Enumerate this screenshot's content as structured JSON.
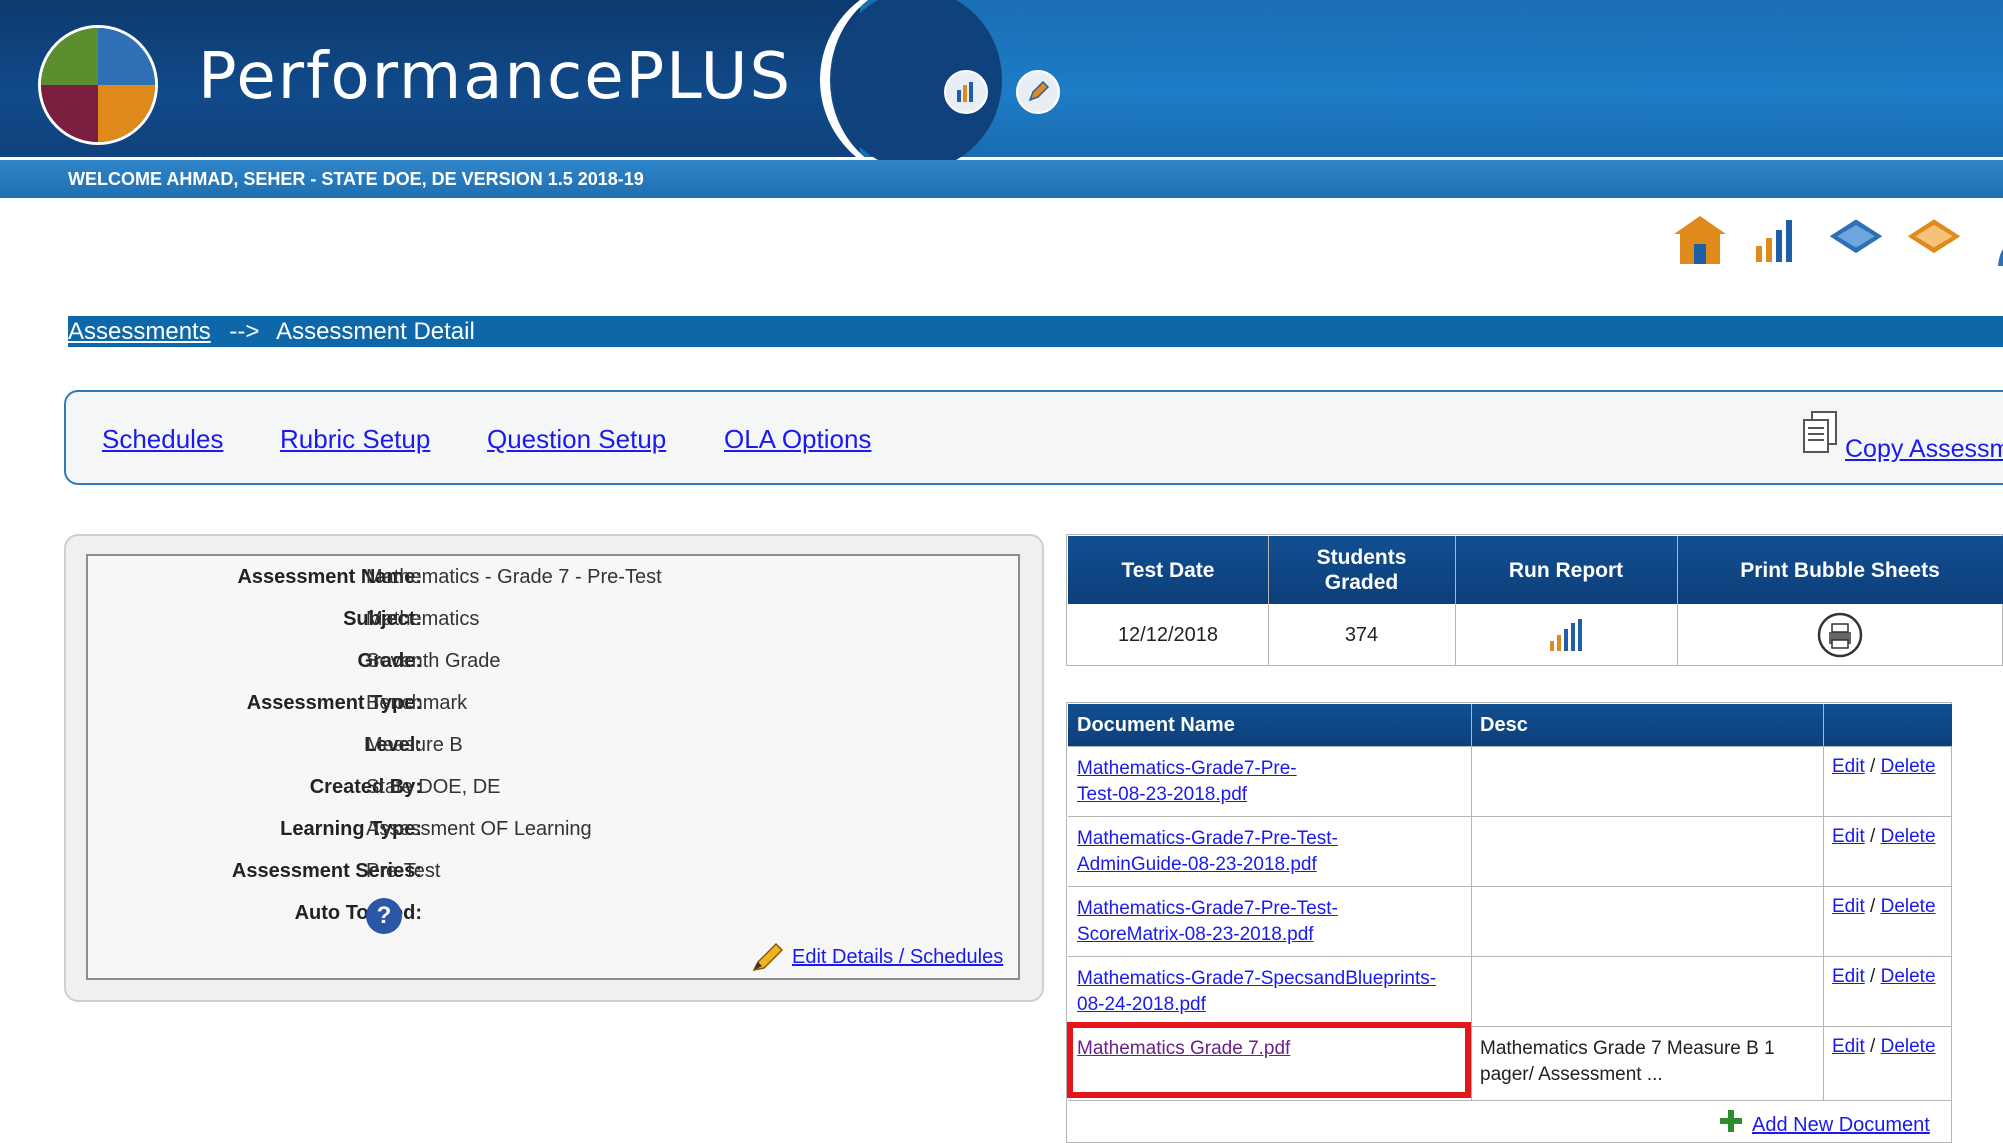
{
  "header": {
    "app_title": "PerformancePLUS",
    "welcome_text": "WELCOME   AHMAD, SEHER - STATE DOE, DE VERSION 1.5   2018-19",
    "icons": [
      "report-chart-icon",
      "edit-pencil-icon"
    ]
  },
  "toolbar_icons": [
    "home-icon",
    "chart-icon",
    "layers-icon",
    "stack-icon",
    "user-icon"
  ],
  "breadcrumb": {
    "link": "Assessments",
    "separator": "-->",
    "current": "Assessment Detail"
  },
  "tabs": {
    "schedules": "Schedules",
    "rubric_setup": "Rubric Setup",
    "question_setup": "Question Setup",
    "ola_options": "OLA Options",
    "copy": "Copy Assessment"
  },
  "details": {
    "rows": [
      {
        "label": "Assessment Name:",
        "value": "Mathematics - Grade 7 - Pre-Test"
      },
      {
        "label": "Subject:",
        "value": "Mathematics"
      },
      {
        "label": "Grade:",
        "value": "Seventh Grade"
      },
      {
        "label": "Assessment Type:",
        "value": "Benchmark"
      },
      {
        "label": "Level:",
        "value": "Measure B"
      },
      {
        "label": "Created By:",
        "value": "State DOE, DE"
      },
      {
        "label": "Learning Type:",
        "value": "Assessment OF Learning"
      },
      {
        "label": "Assessment Series:",
        "value": "Pre-Test"
      },
      {
        "label": "Auto Totaled:",
        "value": ""
      }
    ],
    "help_symbol": "?",
    "edit_link": "Edit Details / Schedules"
  },
  "stats": {
    "headers": [
      "Test Date",
      "Students Graded",
      "Run Report",
      "Print Bubble Sheets"
    ],
    "values": {
      "test_date": "12/12/2018",
      "students_graded": "374"
    }
  },
  "documents": {
    "headers": [
      "Document Name",
      "Desc",
      ""
    ],
    "rows": [
      {
        "name": "Mathematics-Grade7-Pre-Test-08-23-2018.pdf",
        "desc": "",
        "edit": "Edit",
        "sep": " / ",
        "delete": "Delete"
      },
      {
        "name": "Mathematics-Grade7-Pre-Test-AdminGuide-08-23-2018.pdf",
        "desc": "",
        "edit": "Edit",
        "sep": " / ",
        "delete": "Delete"
      },
      {
        "name": "Mathematics-Grade7-Pre-Test-ScoreMatrix-08-23-2018.pdf",
        "desc": "",
        "edit": "Edit",
        "sep": " / ",
        "delete": "Delete"
      },
      {
        "name": "Mathematics-Grade7-SpecsandBlueprints-08-24-2018.pdf",
        "desc": "",
        "edit": "Edit",
        "sep": " / ",
        "delete": "Delete"
      },
      {
        "name": "Mathematics Grade 7.pdf",
        "desc": "Mathematics Grade 7 Measure B 1 pager/ Assessment ...",
        "edit": "Edit",
        "sep": " / ",
        "delete": "Delete"
      }
    ],
    "add_link": "Add New Document"
  },
  "colors": {
    "header_dark": "#0f427c",
    "header_light": "#1d7cc6",
    "link": "#1a1aee",
    "highlight": "#e3171b"
  }
}
